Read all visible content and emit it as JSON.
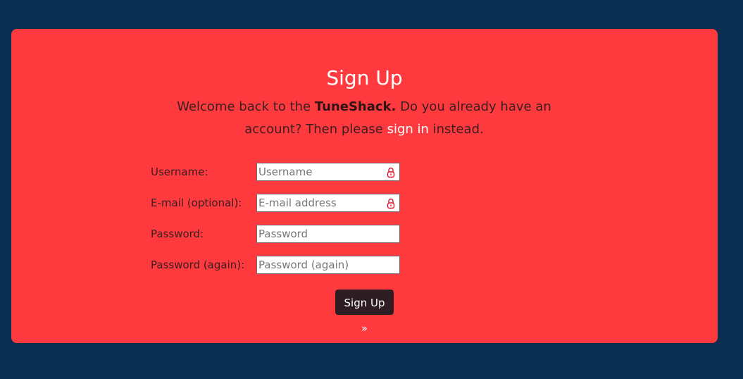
{
  "form": {
    "title": "Sign Up",
    "intro": {
      "part1": "Welcome back to the ",
      "brand": "TuneShack.",
      "part2": " Do you already have an account? Then please ",
      "link": "sign in",
      "part3": " instead."
    },
    "fields": [
      {
        "label": "Username:",
        "placeholder": "Username",
        "icon": "lock-icon"
      },
      {
        "label": "E-mail (optional):",
        "placeholder": "E-mail address",
        "icon": "lock-icon"
      },
      {
        "label": "Password:",
        "placeholder": "Password"
      },
      {
        "label": "Password (again):",
        "placeholder": "Password (again)"
      }
    ],
    "submit_label": "Sign Up »"
  },
  "colors": {
    "page_background": "#082e52",
    "card_background": "#ff3a3f",
    "button_background": "#2e1e24",
    "icon_color": "#e0102a"
  }
}
